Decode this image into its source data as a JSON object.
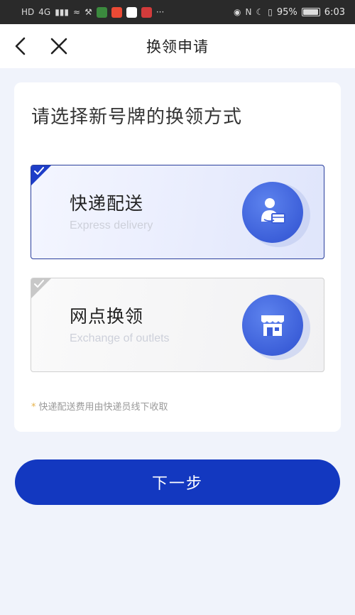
{
  "status_bar": {
    "left_glyphs": [
      "HD",
      "4G",
      "▮▮▮",
      "≈",
      "⚒"
    ],
    "app_icon_colors": [
      "#3b8a3e",
      "#e94a35",
      "#ffffff",
      "#d23b3b"
    ],
    "more": "···",
    "right_glyphs": [
      "◉",
      "N",
      "☾",
      "▯"
    ],
    "battery_percent": "95%",
    "time": "6:03"
  },
  "nav": {
    "title": "换领申请"
  },
  "card": {
    "heading": "请选择新号牌的换领方式",
    "options": [
      {
        "title": "快递配送",
        "subtitle": "Express delivery",
        "selected": true,
        "icon": "courier-icon"
      },
      {
        "title": "网点换领",
        "subtitle": "Exchange of outlets",
        "selected": false,
        "icon": "storefront-icon"
      }
    ],
    "note_star": "*",
    "note": "快递配送费用由快递员线下收取"
  },
  "next_button": {
    "label": "下一步"
  },
  "colors": {
    "primary": "#1338c0",
    "selected_border": "#2a3f9c",
    "icon_blue": "#3c5fd9"
  }
}
